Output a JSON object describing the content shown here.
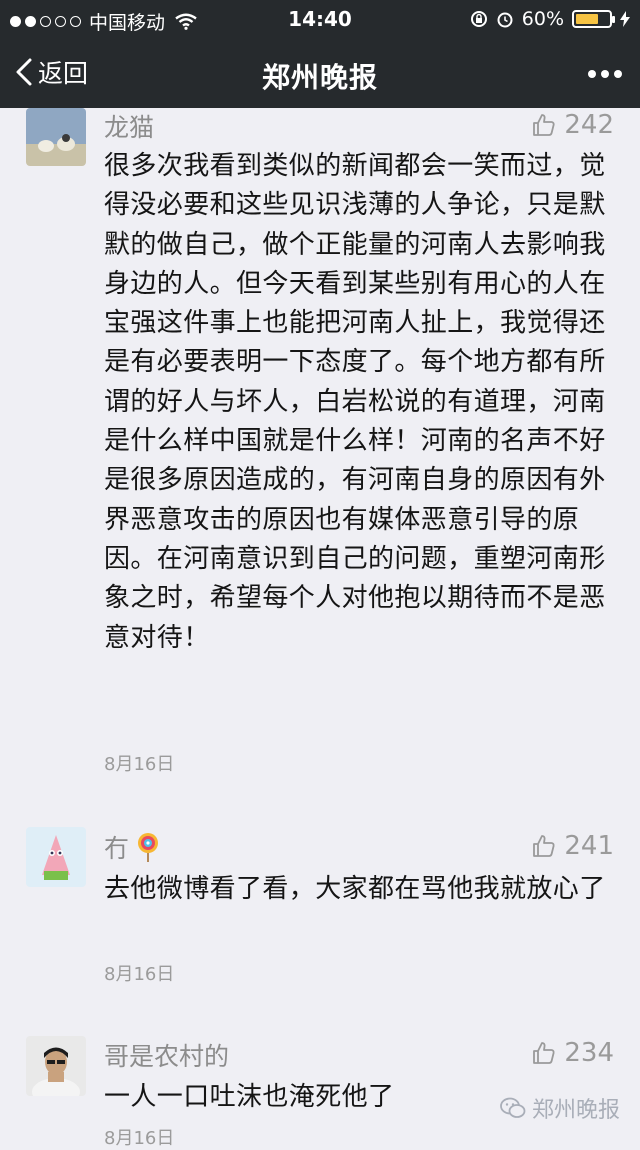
{
  "status_bar": {
    "carrier": "中国移动",
    "time": "14:40",
    "battery": "60%"
  },
  "nav": {
    "back_label": "返回",
    "title": "郑州晚报"
  },
  "comments": [
    {
      "name": "龙猫",
      "likes": "242",
      "text": "很多次我看到类似的新闻都会一笑而过，觉得没必要和这些见识浅薄的人争论，只是默默的做自己，做个正能量的河南人去影响我身边的人。但今天看到某些别有用心的人在宝强这件事上也能把河南人扯上，我觉得还是有必要表明一下态度了。每个地方都有所谓的好人与坏人，白岩松说的有道理，河南是什么样中国就是什么样！河南的名声不好是很多原因造成的，有河南自身的原因有外界恶意攻击的原因也有媒体恶意引导的原因。在河南意识到自己的问题，重塑河南形象之时，希望每个人对他抱以期待而不是恶意对待！",
      "date": "8月16日"
    },
    {
      "name": "冇",
      "likes": "241",
      "text": "去他微博看了看，大家都在骂他我就放心了",
      "date": "8月16日"
    },
    {
      "name": "哥是农村的",
      "likes": "234",
      "text": "一人一口吐沫也淹死他了",
      "date": "8月16日"
    }
  ],
  "watermark": "郑州晚报"
}
